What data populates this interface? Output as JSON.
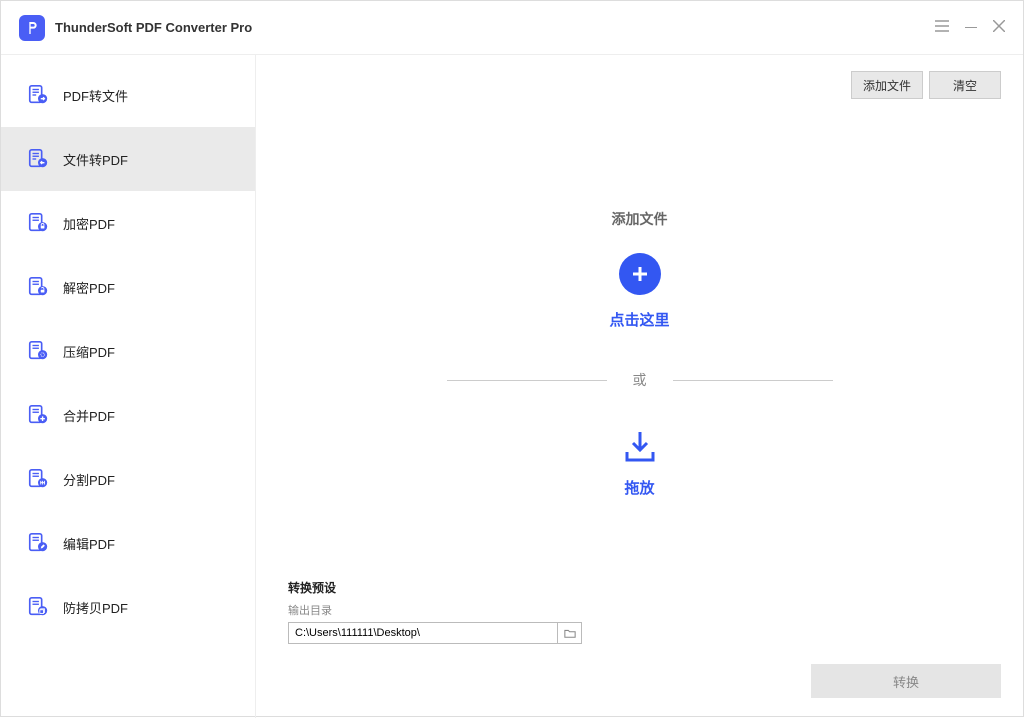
{
  "appTitle": "ThunderSoft PDF Converter Pro",
  "sidebar": {
    "items": [
      {
        "label": "PDF转文件"
      },
      {
        "label": "文件转PDF"
      },
      {
        "label": "加密PDF"
      },
      {
        "label": "解密PDF"
      },
      {
        "label": "压缩PDF"
      },
      {
        "label": "合并PDF"
      },
      {
        "label": "分割PDF"
      },
      {
        "label": "编辑PDF"
      },
      {
        "label": "防拷贝PDF"
      }
    ]
  },
  "toolbar": {
    "addFile": "添加文件",
    "clear": "清空"
  },
  "center": {
    "addFileTitle": "添加文件",
    "clickHere": "点击这里",
    "or": "或",
    "drop": "拖放"
  },
  "bottom": {
    "presetTitle": "转换预设",
    "outputLabel": "输出目录",
    "outputPath": "C:\\Users\\111111\\Desktop\\",
    "convert": "转换"
  }
}
